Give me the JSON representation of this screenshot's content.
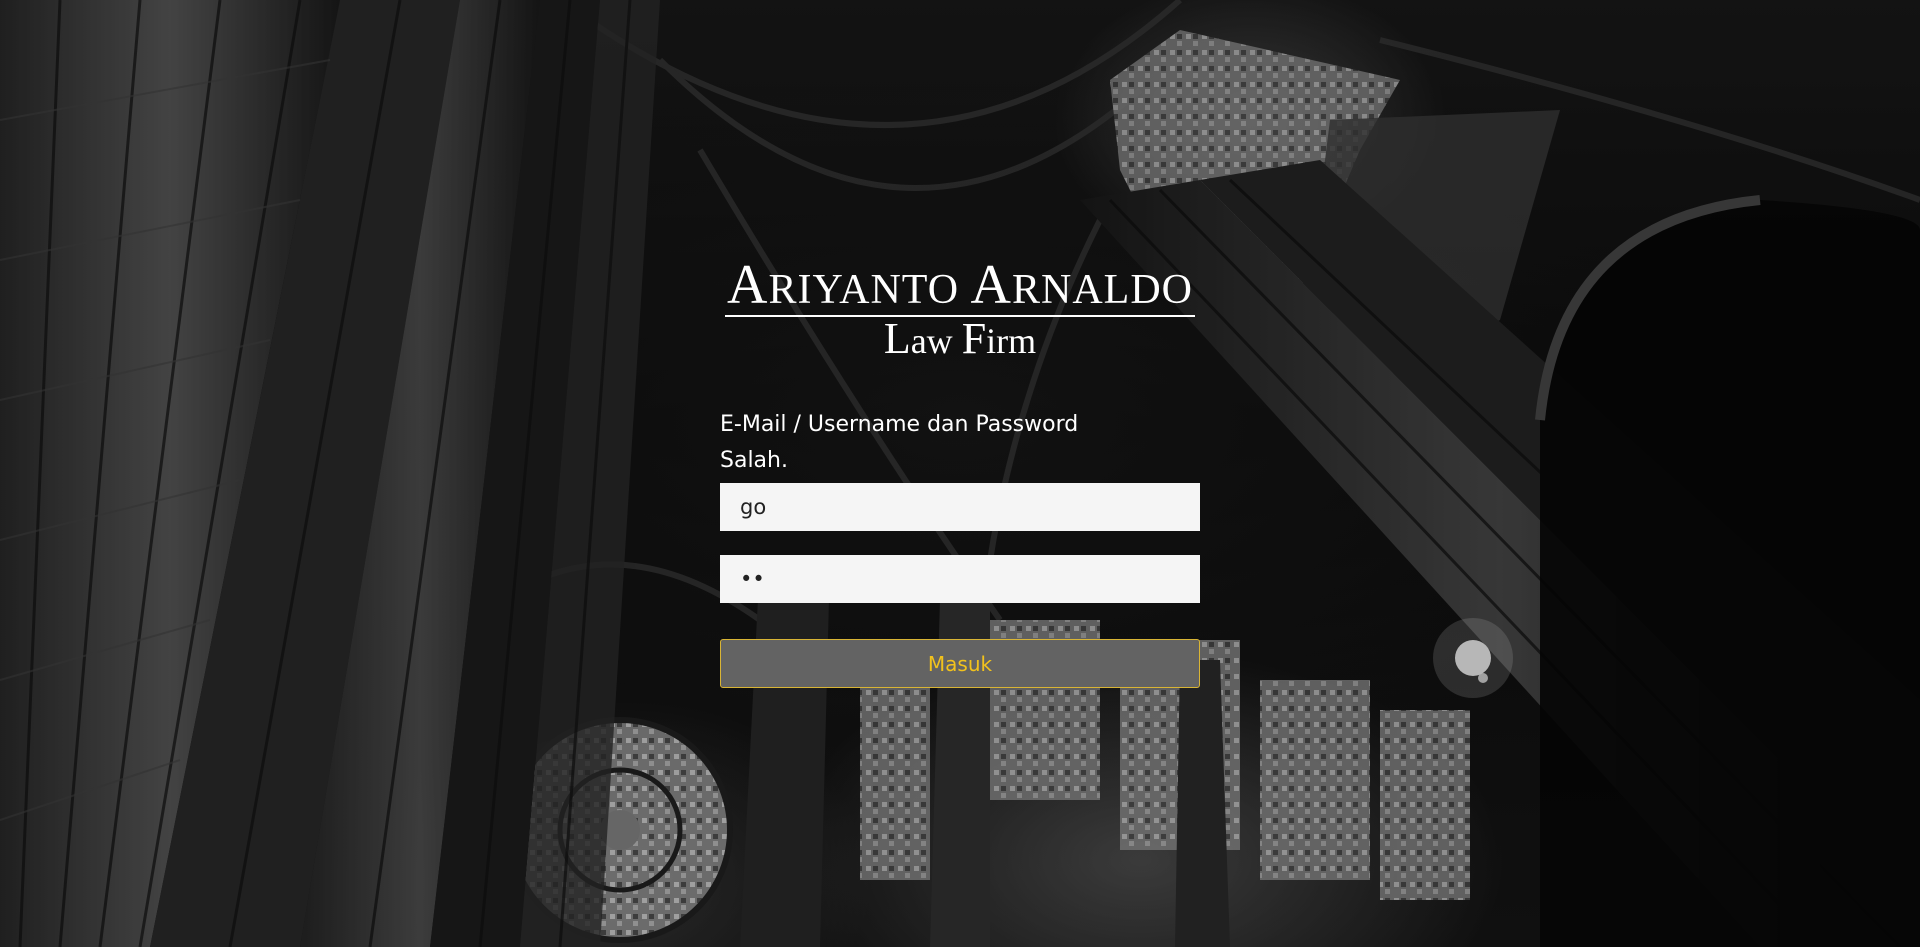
{
  "brand": {
    "line1_cap1": "A",
    "line1_rest1": "RIYANTO ",
    "line1_cap2": "A",
    "line1_rest2": "RNALDO",
    "line2_cap1": "L",
    "line2_rest1": "aw ",
    "line2_cap2": "F",
    "line2_rest2": "irm"
  },
  "login": {
    "error_message": "E-Mail / Username dan Password Salah.",
    "username_value": "go",
    "password_value": "••",
    "submit_label": "Masuk"
  },
  "colors": {
    "button_bg": "#636363",
    "button_text": "#f2c21c",
    "button_border": "#d9b535",
    "input_bg": "#f5f5f5"
  }
}
